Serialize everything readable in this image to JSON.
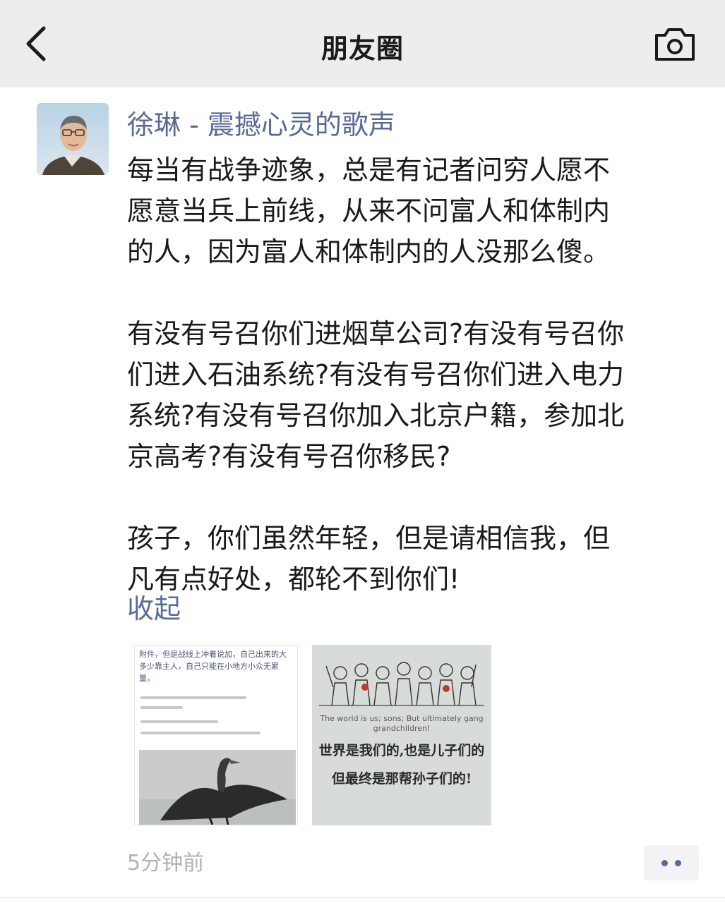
{
  "nav": {
    "title": "朋友圈",
    "back_icon": "chevron-left-icon",
    "camera_icon": "camera-icon"
  },
  "post": {
    "author": "徐琳 - 震撼心灵的歌声",
    "paragraphs": [
      "每当有战争迹象，总是有记者问穷人愿不\n愿意当兵上前线，从来不问富人和体制内\n的人，因为富人和体制内的人没那么傻。",
      "有没有号召你们进烟草公司?有没有号召你\n们进入石油系统?有没有号召你们进入电力\n系统?有没有号召你加入北京户籍，参加北\n京高考?有没有号召你移民?",
      "孩子，你们虽然年轻，但是请相信我，但\n凡有点好处，都轮不到你们!"
    ],
    "collapse_label": "收起",
    "images": [
      {
        "text": "附件，但是战线上冲着说加，自己出来的大多少靠主人，自己只能在小地方小众无累量。",
        "caption": "",
        "icon": "bird-photo"
      },
      {
        "text": "",
        "caption_en": "The world is us; sons; But ultimately gang grandchildren!",
        "caption_cn_1": "世界是我们的,也是儿子们的",
        "caption_cn_2": "但最终是那帮孙子们的!",
        "icon": "cartoon-crowd"
      }
    ],
    "timestamp": "5分钟前",
    "more_icon": "more-dots-icon"
  },
  "colors": {
    "nav_background": "#ededed",
    "link_blue": "#576b95",
    "text_dark": "#1a1a1a",
    "timestamp_gray": "#b2b2b2"
  }
}
